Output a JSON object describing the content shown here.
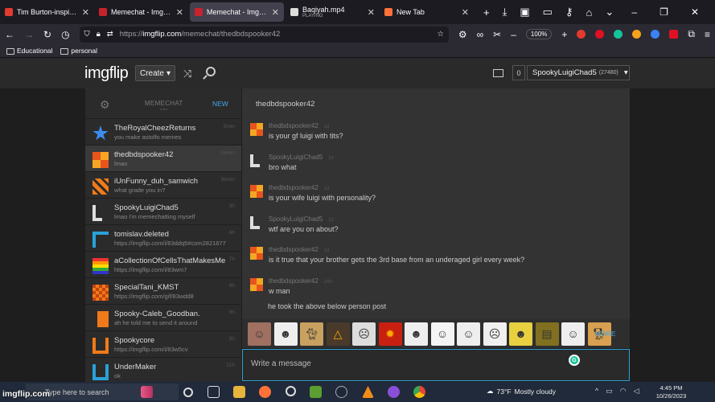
{
  "browser": {
    "tabs": [
      {
        "title": "Tim Burton-inspired pi",
        "color": "#e33b2e",
        "active": false
      },
      {
        "title": "Memechat - Imgflip",
        "color": "#c8232c",
        "active": false
      },
      {
        "title": "Memechat - Imgflip",
        "color": "#c8232c",
        "active": true
      },
      {
        "title": "Baqiyah.mp4",
        "subtitle": "PLAYING",
        "color": "#dddddd",
        "active": false
      },
      {
        "title": "New Tab",
        "color": "#ff7139",
        "active": false
      }
    ],
    "url_scheme": "https://",
    "url_host": "imgflip.com",
    "url_path": "/memechat/thedbdspooker42",
    "zoom": "100%",
    "bookmarks": [
      "Educational",
      "personal"
    ]
  },
  "site": {
    "logo_a": "img",
    "logo_b": "flip",
    "create_label": "Create",
    "notif_count": "0",
    "username": "SpookyLuigiChad5",
    "points": "(27480)"
  },
  "sidebar": {
    "title": "MEMECHAT",
    "beta": "beta",
    "new_label": "NEW",
    "conversations": [
      {
        "name": "TheRoyalCheezReturns",
        "preview": "you make astolfo memes",
        "time": "5min",
        "avatar": "star"
      },
      {
        "name": "thedbdspooker42",
        "preview": "lmao",
        "time": "19min",
        "avatar": "xsun",
        "selected": true
      },
      {
        "name": "iUnFunny_duh_samwich",
        "preview": "what grade you in?",
        "time": "36min",
        "avatar": "orange1"
      },
      {
        "name": "SpookyLuigiChad5",
        "preview": "lmao i'm memechatting myself",
        "time": "3h",
        "avatar": "L"
      },
      {
        "name": "tomislav.deleted",
        "preview": "https://imgflip.com/i/83ddq5#com2821677",
        "time": "6h",
        "avatar": "blue"
      },
      {
        "name": "aCollectionOfCellsThatMakesMe",
        "preview": "https://imgflip.com/i/83wm7",
        "time": "7h",
        "avatar": "pride"
      },
      {
        "name": "SpecialTani_KMST",
        "preview": "https://imgflip.com/gif/83wdd8",
        "time": "8h",
        "avatar": "orange2"
      },
      {
        "name": "Spooky-Caleb_Goodban.",
        "preview": "ah he told me to send it around",
        "time": "8h",
        "avatar": "orange3"
      },
      {
        "name": "Spookycore",
        "preview": "https://imgflip.com/i/83w5cv",
        "time": "9h",
        "avatar": "orange4"
      },
      {
        "name": "UnderMaker",
        "preview": "ok",
        "time": "21h",
        "avatar": "blue2"
      }
    ]
  },
  "chat": {
    "title": "thedbdspooker42",
    "messages": [
      {
        "author": "thedbdspooker42",
        "time": "1d",
        "text": "is your gf luigi with tits?",
        "avatar": "xsun"
      },
      {
        "author": "SpookyLuigiChad5",
        "time": "1d",
        "text": "bro what",
        "avatar": "L"
      },
      {
        "author": "thedbdspooker42",
        "time": "1d",
        "text": "is your wife luigi with personality?",
        "avatar": "xsun"
      },
      {
        "author": "SpookyLuigiChad5",
        "time": "1d",
        "text": "wtf are you on about?",
        "avatar": "L"
      },
      {
        "author": "thedbdspooker42",
        "time": "1d",
        "text": "is it true that your brother gets the 3rd base from an underaged girl every week?",
        "avatar": "xsun"
      },
      {
        "author": "thedbdspooker42",
        "time": "24h",
        "text": "w man",
        "avatar": "xsun"
      }
    ],
    "last_line": "he took the above below person post",
    "more_label": "MORE",
    "input_placeholder": "Write a message",
    "meme_templates": [
      "woman-face",
      "troll-face",
      "cat",
      "illuminati",
      "me-gusta",
      "explosion",
      "rage-face",
      "derp",
      "yao-ming",
      "forever-alone",
      "spongebob",
      "deal-with-it",
      "lol-face",
      "doge"
    ]
  },
  "taskbar": {
    "watermark": "imgflip.com",
    "search_placeholder": "Type here to search",
    "weather_temp": "73°F",
    "weather_desc": "Mostly cloudy",
    "time": "4:45 PM",
    "date": "10/26/2023"
  }
}
